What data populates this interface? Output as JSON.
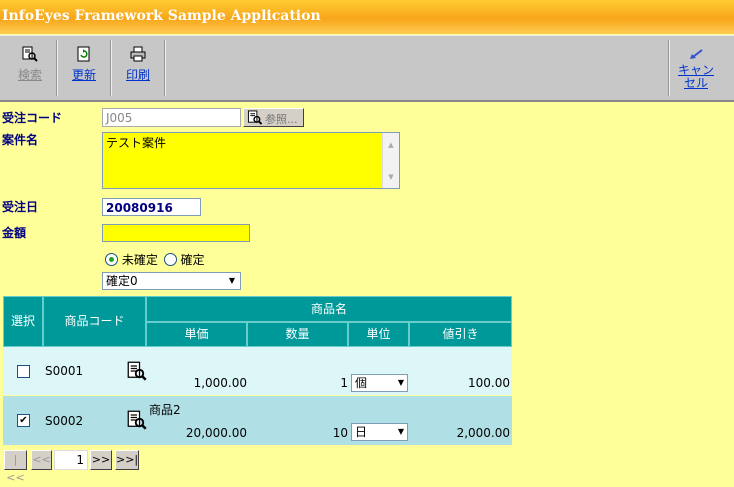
{
  "app": {
    "title": "InfoEyes Framework Sample Application"
  },
  "toolbar": {
    "search_label": "検索",
    "refresh_label": "更新",
    "print_label": "印刷",
    "cancel_line1": "キャン",
    "cancel_line2": "セル"
  },
  "form": {
    "order_code_label": "受注コード",
    "order_code_value": "J005",
    "browse_label": "参照...",
    "case_name_label": "案件名",
    "case_name_value": "テスト案件",
    "order_date_label": "受注日",
    "order_date_value": "20080916",
    "amount_label": "金額",
    "amount_value": "",
    "radio_unconfirmed": "未確定",
    "radio_confirmed": "確定",
    "status_select": "確定0"
  },
  "grid": {
    "headers": {
      "select": "選択",
      "product_code": "商品コード",
      "product_name": "商品名",
      "unit_price": "単価",
      "quantity": "数量",
      "unit": "単位",
      "discount": "値引き"
    },
    "rows": [
      {
        "checked": false,
        "code": "S0001",
        "name": "",
        "price": "1,000.00",
        "qty": "1",
        "unit": "個",
        "discount": "100.00"
      },
      {
        "checked": true,
        "code": "S0002",
        "name": "商品2",
        "price": "20,000.00",
        "qty": "10",
        "unit": "日",
        "discount": "2,000.00"
      }
    ]
  },
  "pager": {
    "first": "|<<",
    "prev": "<<",
    "page": "1",
    "next": ">>",
    "last": ">>|"
  }
}
